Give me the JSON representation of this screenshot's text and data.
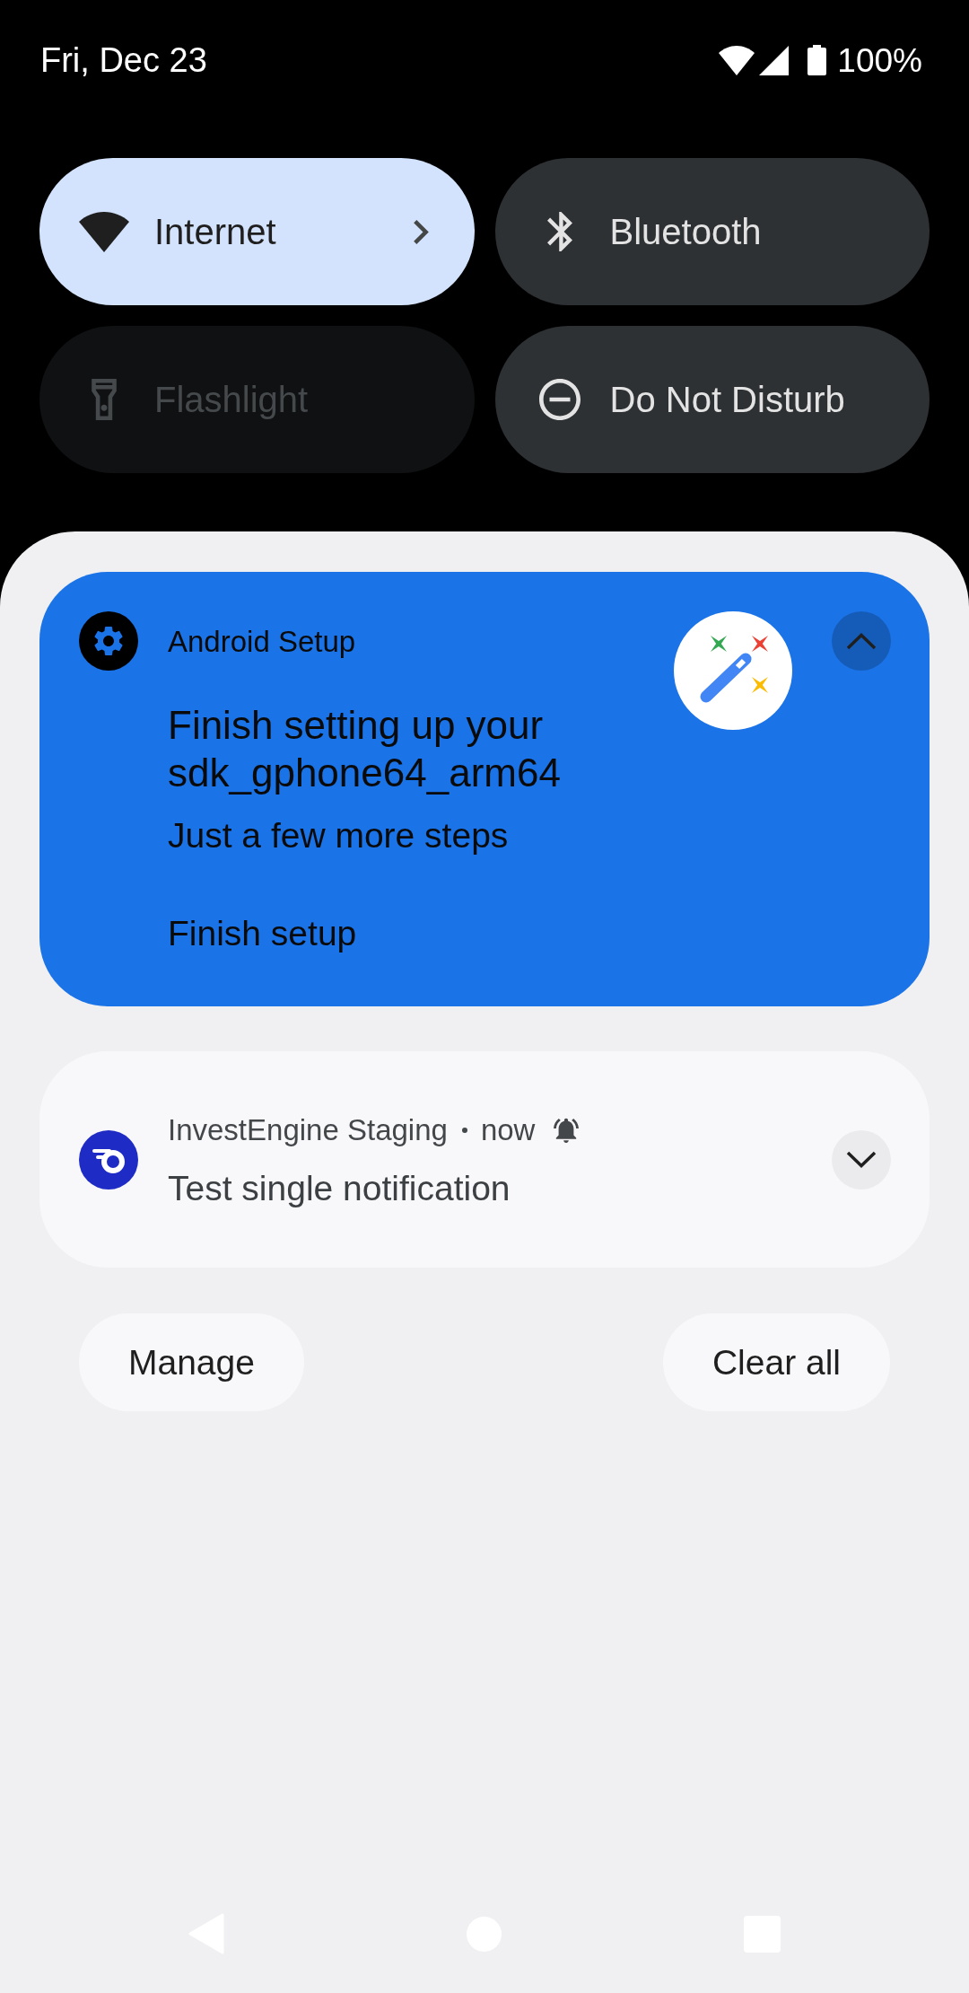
{
  "status_bar": {
    "date": "Fri, Dec 23",
    "battery": "100%"
  },
  "quick_settings": [
    {
      "kind": "internet",
      "label": "Internet",
      "on": true,
      "disabled": false,
      "chevron": true
    },
    {
      "kind": "bluetooth",
      "label": "Bluetooth",
      "on": false,
      "disabled": false,
      "chevron": false
    },
    {
      "kind": "flashlight",
      "label": "Flashlight",
      "on": false,
      "disabled": true,
      "chevron": false
    },
    {
      "kind": "do_not_disturb",
      "label": "Do Not Disturb",
      "on": false,
      "disabled": false,
      "chevron": false
    }
  ],
  "notifications": [
    {
      "app": "Android Setup",
      "color": "#1b73e8",
      "expanded": true,
      "alerted": false,
      "title": "Finish setting up your sdk_gphone64_arm64",
      "text": "Just a few more steps",
      "actions": [
        "Finish setup"
      ]
    },
    {
      "app": "InvestEngine Staging",
      "time": "now",
      "color": "#f8f8fa",
      "expanded": false,
      "alerted": true,
      "title": "Test single notification"
    }
  ],
  "footer_buttons": [
    "Manage",
    "Clear all"
  ]
}
